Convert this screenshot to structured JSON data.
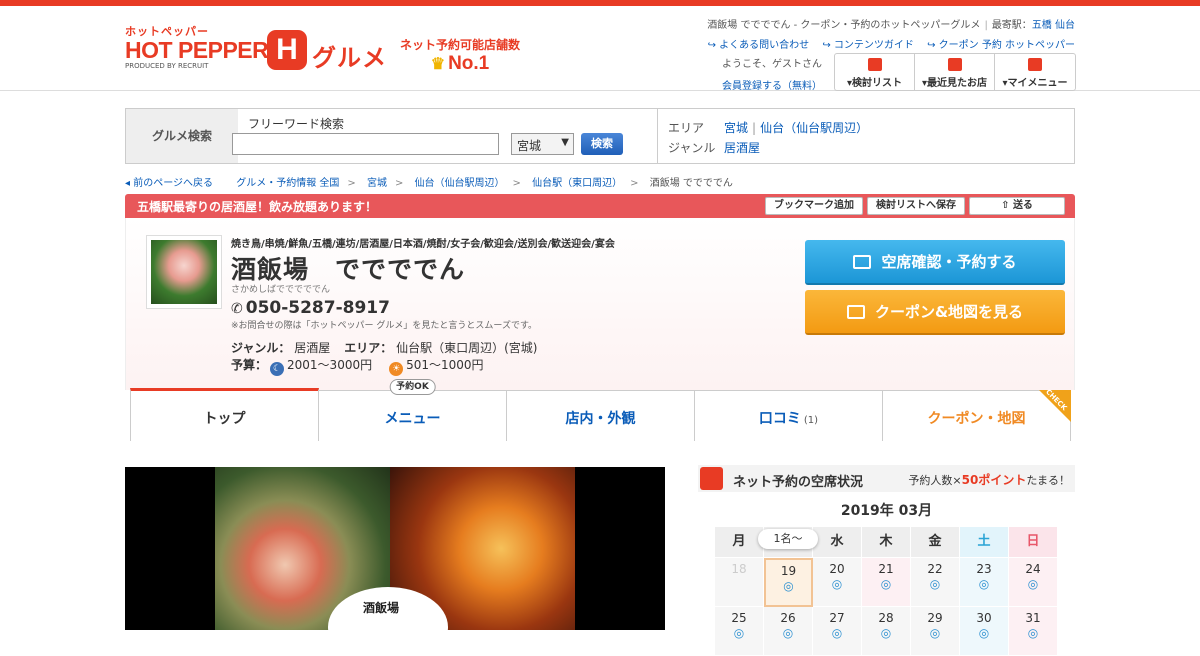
{
  "header": {
    "logo_small": "ホットペッパー",
    "logo_main": "HOT PEPPER",
    "logo_badge": "H",
    "logo_gurume": "グルメ",
    "produced_by": "PRODUCED BY RECRUIT",
    "no1_text": "ネット予約可能店舗数",
    "no1_rank": "No.1",
    "page_title": "酒飯場 ででででん - クーポン・予約のホットペッパーグルメ",
    "nearest_label": "最寄駅：",
    "nearest_1": "五橋",
    "nearest_2": "仙台",
    "links": [
      "よくある問い合わせ",
      "コンテンツガイド",
      "クーポン 予約 ホットペッパー"
    ],
    "welcome": "ようこそ、ゲストさん",
    "register": "会員登録する（無料）",
    "buttons": [
      "検討リスト",
      "最近見たお店",
      "マイメニュー"
    ]
  },
  "search": {
    "label": "グルメ検索",
    "free_word_caption": "フリーワード検索",
    "free_word_value": "",
    "pref_value": "宮城",
    "go_label": "検索",
    "area_key": "エリア",
    "area_1": "宮城",
    "area_2": "仙台（仙台駅周辺）",
    "genre_key": "ジャンル",
    "genre_value": "居酒屋"
  },
  "breadcrumb": {
    "back": "前のページへ戻る",
    "items": [
      "グルメ・予約情報 全国",
      "宮城",
      "仙台（仙台駅周辺）",
      "仙台駅（東口周辺）"
    ],
    "current": "酒飯場 ででででん"
  },
  "shop": {
    "catch": "五橋駅最寄りの居酒屋！飲み放題あります！",
    "action_buttons": [
      "ブックマーク追加",
      "検討リストへ保存",
      "送る"
    ],
    "tags": "焼き鳥/串焼/鮮魚/五橋/連坊/居酒屋/日本酒/焼酎/女子会/歓迎会/送別会/歓送迎会/宴会",
    "name": "酒飯場　ででででん",
    "kana": "さかめしばでででででん",
    "tel": "050-5287-8917",
    "tel_note": "※お問合せの際は「ホットペッパー グルメ」を見たと言うとスムーズです。",
    "genre_label": "ジャンル：",
    "genre": "居酒屋",
    "area_label": "エリア：",
    "area": "仙台駅（東口周辺）(宮城)",
    "budget_label": "予算：",
    "budget_dinner": "2001～3000円",
    "budget_lunch": "501～1000円",
    "reserve_button": "空席確認・予約する",
    "coupon_button": "クーポン&地図を見る"
  },
  "tabs": [
    {
      "label": "トップ"
    },
    {
      "label": "メニュー",
      "badge": "予約OK"
    },
    {
      "label": "店内・外観"
    },
    {
      "label": "口コミ",
      "count": "(1)"
    },
    {
      "label": "クーポン・地図",
      "corner": "CHECK"
    }
  ],
  "photo": {
    "sign_text": "酒飯場"
  },
  "calendar": {
    "title": "ネット予約の空席状況",
    "points_pre": "予約人数×",
    "points_num": "50ポイント",
    "points_post": "たまる！",
    "month": "2019年 03月",
    "people_bubble": "1名～",
    "dow": [
      "月",
      "火",
      "水",
      "木",
      "金",
      "土",
      "日"
    ],
    "week1": [
      "18",
      "19",
      "20",
      "21",
      "22",
      "23",
      "24"
    ],
    "week2": [
      "25",
      "26",
      "27",
      "28",
      "29",
      "30",
      "31"
    ],
    "available_mark": "◎",
    "colors": {
      "accent": "#e83b24",
      "reserve": "#1c96d6",
      "coupon": "#f39a12"
    }
  }
}
